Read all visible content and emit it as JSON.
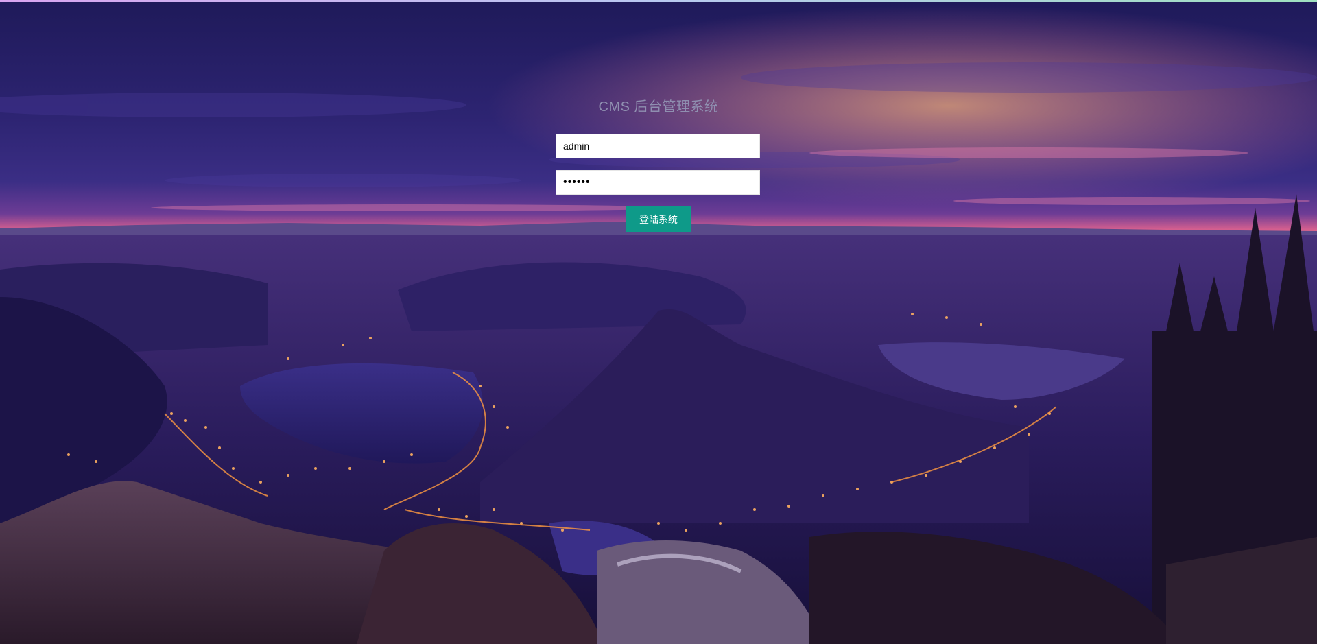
{
  "login": {
    "title": "CMS 后台管理系统",
    "username_value": "admin",
    "password_value": "123456",
    "submit_label": "登陆系统"
  },
  "colors": {
    "button": "#0e9a89",
    "title": "#8f8fb0",
    "sky_top": "#241f5e",
    "sky_glow": "#f0709a"
  },
  "background": {
    "description_icon": "night-city-landscape-photo"
  }
}
